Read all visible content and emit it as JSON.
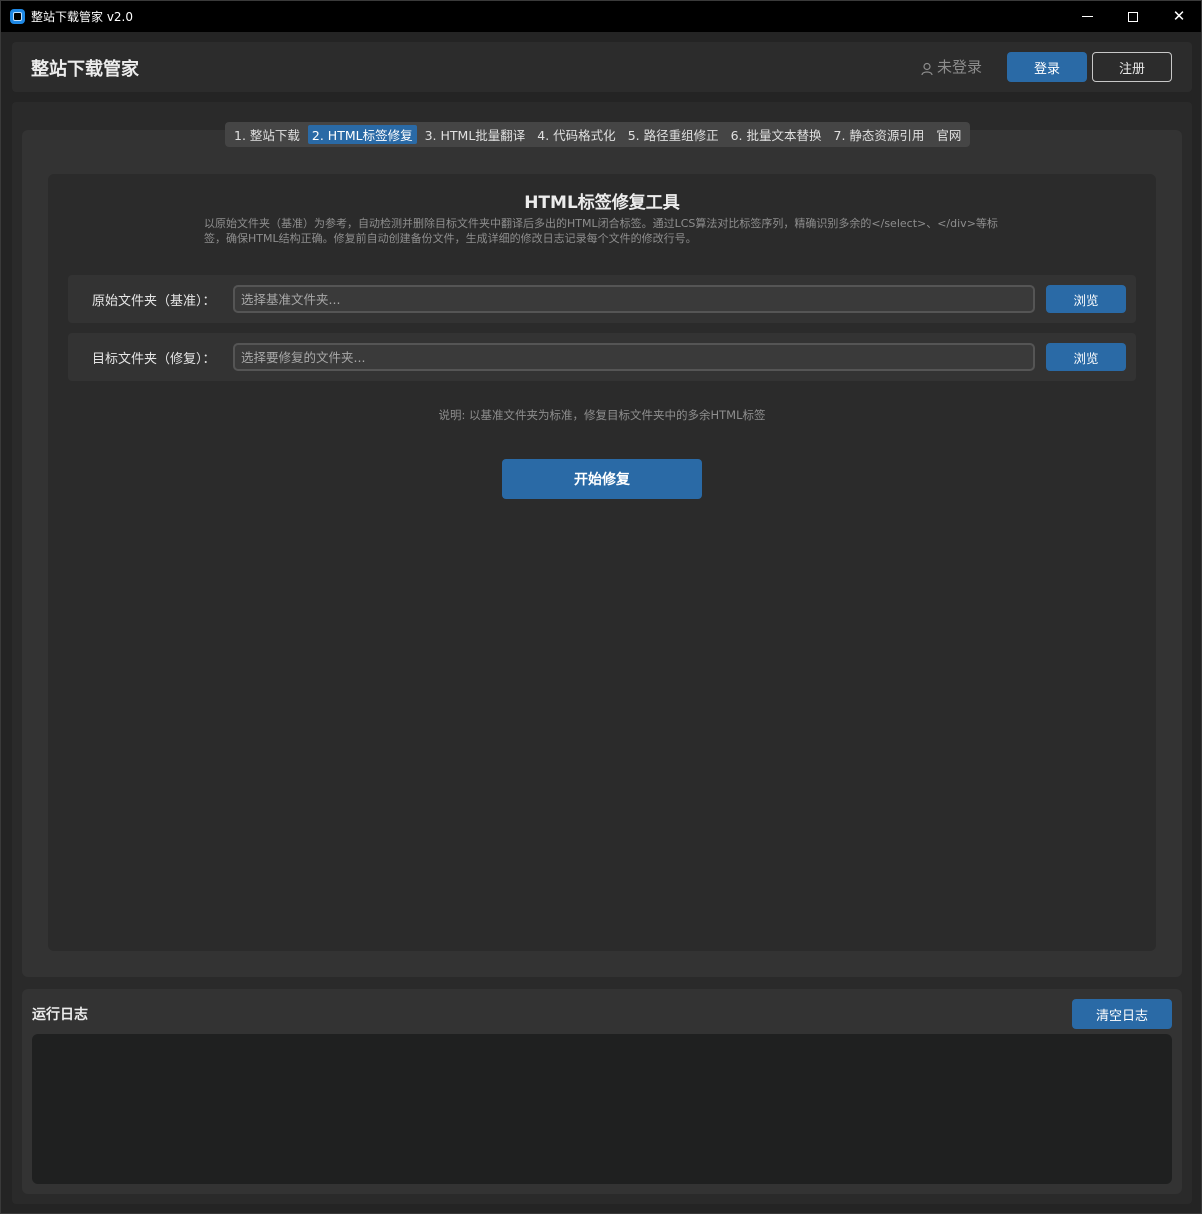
{
  "window": {
    "title": "整站下载管家 v2.0",
    "minimize_glyph": "",
    "close_glyph": "✕"
  },
  "header": {
    "brand": "整站下载管家",
    "user_status": "未登录",
    "login_label": "登录",
    "register_label": "注册"
  },
  "tabs": [
    {
      "label": "1. 整站下载",
      "active": false
    },
    {
      "label": "2. HTML标签修复",
      "active": true
    },
    {
      "label": "3. HTML批量翻译",
      "active": false
    },
    {
      "label": "4. 代码格式化",
      "active": false
    },
    {
      "label": "5. 路径重组修正",
      "active": false
    },
    {
      "label": "6. 批量文本替换",
      "active": false
    },
    {
      "label": "7. 静态资源引用",
      "active": false
    },
    {
      "label": "官网",
      "active": false
    }
  ],
  "tool": {
    "title": "HTML标签修复工具",
    "description": "以原始文件夹（基准）为参考，自动检测并删除目标文件夹中翻译后多出的HTML闭合标签。通过LCS算法对比标签序列，精确识别多余的</select>、</div>等标签，确保HTML结构正确。修复前自动创建备份文件，生成详细的修改日志记录每个文件的修改行号。",
    "source": {
      "label": "原始文件夹（基准）：",
      "value": "",
      "placeholder": "选择基准文件夹...",
      "browse_label": "浏览"
    },
    "target": {
      "label": "目标文件夹（修复）：",
      "value": "",
      "placeholder": "选择要修复的文件夹...",
      "browse_label": "浏览"
    },
    "note": "说明: 以基准文件夹为标准，修复目标文件夹中的多余HTML标签",
    "start_label": "开始修复"
  },
  "log": {
    "title": "运行日志",
    "clear_label": "清空日志",
    "content": ""
  },
  "colors": {
    "accent": "#2a6aa6",
    "background": "#242424",
    "panel": "#333333",
    "log_bg": "#1f2020"
  }
}
